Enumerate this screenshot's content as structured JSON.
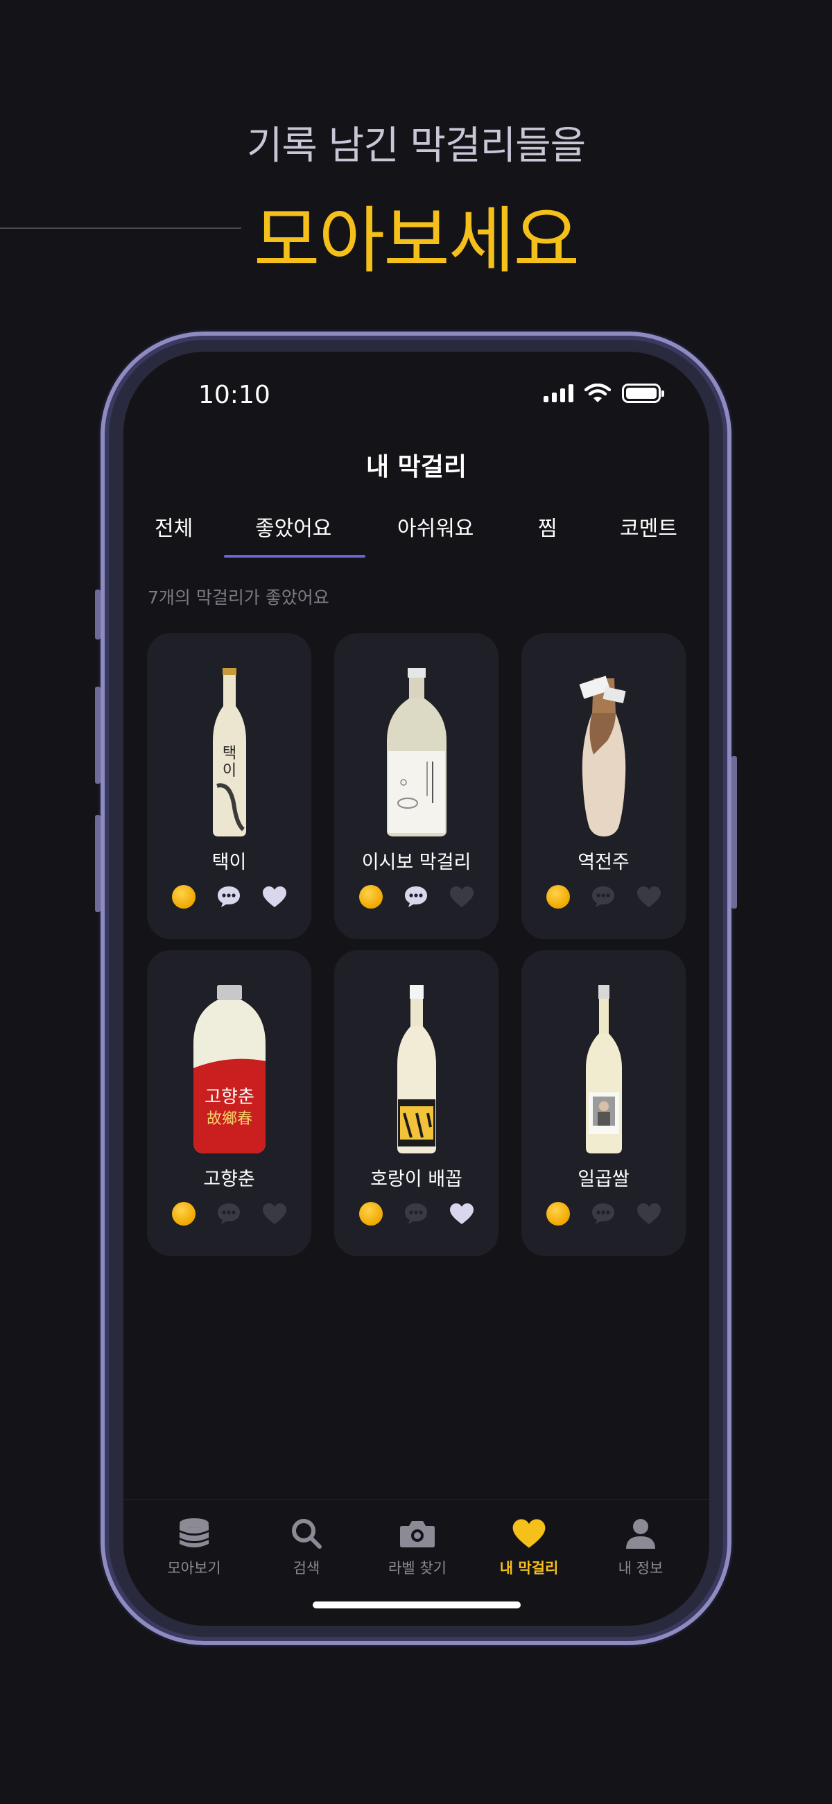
{
  "promo": {
    "subtitle": "기록 남긴 막걸리들을",
    "headline": "모아보세요"
  },
  "status_bar": {
    "time": "10:10"
  },
  "header": {
    "title": "내 막걸리"
  },
  "tabs": [
    {
      "label": "전체",
      "selected": false
    },
    {
      "label": "좋았어요",
      "selected": true
    },
    {
      "label": "아쉬워요",
      "selected": false
    },
    {
      "label": "찜",
      "selected": false
    },
    {
      "label": "코멘트",
      "selected": false
    }
  ],
  "count_text": "7개의 막걸리가 좋았어요",
  "cards": [
    {
      "name": "택이",
      "comment_active": true,
      "liked": true
    },
    {
      "name": "이시보 막걸리",
      "comment_active": true,
      "liked": false
    },
    {
      "name": "역전주",
      "comment_active": false,
      "liked": false
    },
    {
      "name": "고향춘",
      "comment_active": false,
      "liked": false
    },
    {
      "name": "호랑이 배꼽",
      "comment_active": false,
      "liked": true
    },
    {
      "name": "일곱쌀",
      "comment_active": false,
      "liked": false
    }
  ],
  "bottom_nav": [
    {
      "label": "모아보기",
      "icon": "coins-stack-icon"
    },
    {
      "label": "검색",
      "icon": "search-icon"
    },
    {
      "label": "라벨 찾기",
      "icon": "camera-icon"
    },
    {
      "label": "내 막걸리",
      "icon": "heart-icon",
      "active": true
    },
    {
      "label": "내 정보",
      "icon": "person-icon"
    }
  ],
  "colors": {
    "accent": "#f5c01a",
    "tab_indicator": "#6a65d8",
    "background": "#141418",
    "card": "#1f1f27"
  }
}
